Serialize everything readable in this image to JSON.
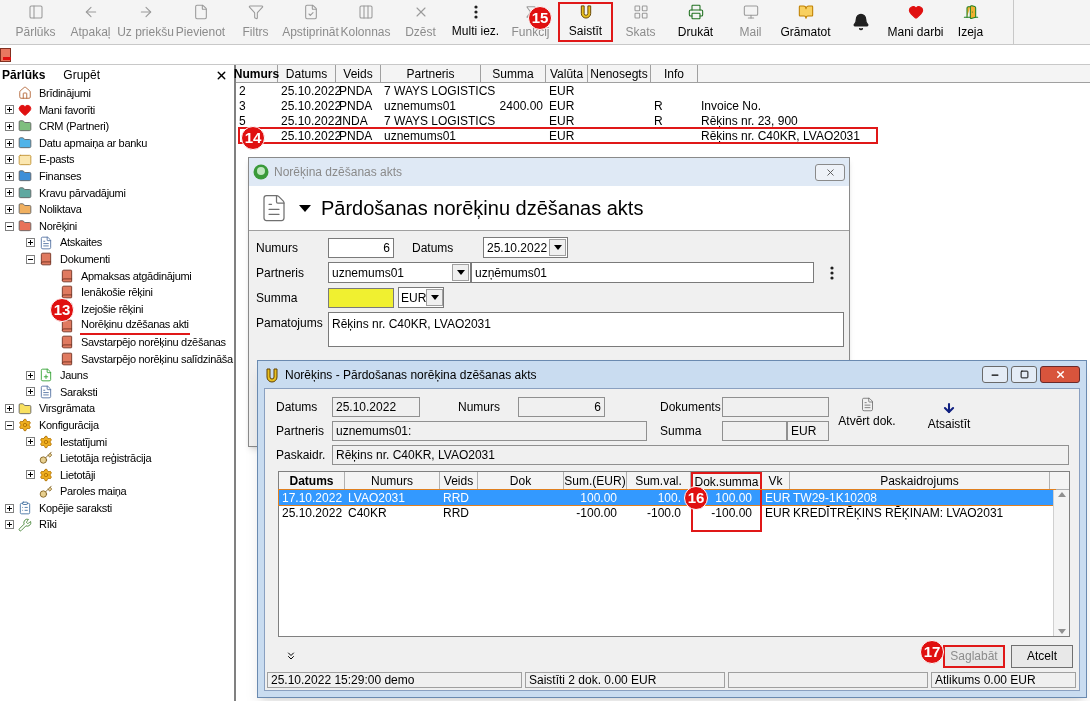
{
  "toolbar": {
    "items": [
      {
        "label": "Pārlūks",
        "kind": "panel",
        "disabled": true,
        "highlighted": false
      },
      {
        "label": "Atpakaļ",
        "kind": "back",
        "disabled": true,
        "highlighted": false
      },
      {
        "label": "Uz priekšu",
        "kind": "forward",
        "disabled": true,
        "highlighted": false
      },
      {
        "label": "Pievienot",
        "kind": "file",
        "disabled": true,
        "highlighted": false
      },
      {
        "label": "Filtrs",
        "kind": "filter",
        "disabled": true,
        "highlighted": false
      },
      {
        "label": "Apstiprināt",
        "kind": "approve",
        "disabled": true,
        "highlighted": false
      },
      {
        "label": "Kolonnas",
        "kind": "columns",
        "disabled": true,
        "highlighted": false
      },
      {
        "label": "Dzēst",
        "kind": "delete",
        "disabled": true,
        "highlighted": false
      },
      {
        "label": "Multi iez.",
        "kind": "more",
        "disabled": false,
        "highlighted": false
      },
      {
        "label": "Funkcij",
        "kind": "function",
        "disabled": true,
        "highlighted": false
      },
      {
        "label": "Saistīt",
        "kind": "link",
        "disabled": false,
        "highlighted": true
      },
      {
        "label": "Skats",
        "kind": "grid",
        "disabled": true,
        "highlighted": false
      },
      {
        "label": "Drukāt",
        "kind": "print",
        "disabled": false,
        "highlighted": false
      },
      {
        "label": "Mail",
        "kind": "mail",
        "disabled": true,
        "highlighted": false
      },
      {
        "label": "Grāmatot",
        "kind": "book",
        "disabled": false,
        "highlighted": false
      },
      {
        "kind": "bell",
        "disabled": false,
        "highlighted": false
      },
      {
        "label": "Mani darbi",
        "kind": "heart",
        "disabled": false,
        "highlighted": false
      },
      {
        "label": "Izeja",
        "kind": "exit",
        "disabled": false,
        "highlighted": false
      }
    ]
  },
  "sidebar": {
    "tabs": [
      {
        "label": "Pārlūks",
        "selected": true
      },
      {
        "label": "Grupēt",
        "selected": false
      }
    ],
    "tree": [
      {
        "label": "Brīdinājumi",
        "kind": "house"
      },
      {
        "label": "Mani favorīti",
        "kind": "heart",
        "expanded": false
      },
      {
        "label": "CRM (Partneri)",
        "kind": "folder",
        "color": "#7fbf7f",
        "expanded": false
      },
      {
        "label": "Datu apmaiņa ar banku",
        "kind": "folder",
        "color": "#4fb3e8",
        "expanded": false
      },
      {
        "label": "E-pasts",
        "kind": "envelope",
        "expanded": false
      },
      {
        "label": "Finanses",
        "kind": "folder",
        "color": "#3f8fd8",
        "expanded": false
      },
      {
        "label": "Kravu pārvadājumi",
        "kind": "folder",
        "color": "#5fa8a0",
        "expanded": false
      },
      {
        "label": "Noliktava",
        "kind": "folder",
        "color": "#f0b060",
        "expanded": false
      },
      {
        "label": "Norēķini",
        "kind": "folder",
        "color": "#e8735a",
        "expanded": true,
        "children": [
          {
            "label": "Atskaites",
            "kind": "list",
            "expanded": false
          },
          {
            "label": "Dokumenti",
            "kind": "book",
            "expanded": true,
            "children": [
              {
                "label": "Apmaksas atgādinājumi",
                "kind": "book",
                "highlighted": false
              },
              {
                "label": "Ienākošie rēķini",
                "kind": "book",
                "highlighted": false
              },
              {
                "label": "Izejošie rēķini",
                "kind": "book",
                "highlighted": false
              },
              {
                "label": "Norēķinu dzēšanas akti",
                "kind": "book",
                "highlighted": true
              },
              {
                "label": "Savstarpējo norēķinu dzēšanas",
                "kind": "book",
                "highlighted": false
              },
              {
                "label": "Savstarpējo norēķinu salīdzināša",
                "kind": "book",
                "highlighted": false
              }
            ]
          },
          {
            "label": "Jauns",
            "kind": "new",
            "expanded": false
          },
          {
            "label": "Saraksti",
            "kind": "list",
            "expanded": false
          }
        ]
      },
      {
        "label": "Virsgrāmata",
        "kind": "folder",
        "color": "#f8e060",
        "expanded": false
      },
      {
        "label": "Konfigurācija",
        "kind": "gear",
        "expanded": true,
        "children": [
          {
            "label": "Iestatījumi",
            "kind": "gear",
            "expanded": false
          },
          {
            "label": "Lietotāja reģistrācija",
            "kind": "key"
          },
          {
            "label": "Lietotāji",
            "kind": "gear",
            "expanded": false
          },
          {
            "label": "Paroles maiņa",
            "kind": "key"
          }
        ]
      },
      {
        "label": "Kopējie saraksti",
        "kind": "clipboard",
        "expanded": false
      },
      {
        "label": "Rīki",
        "kind": "tools",
        "expanded": false
      }
    ]
  },
  "table": {
    "columns": [
      "Numurs",
      "Datums",
      "Veids",
      "Partneris",
      "Summa",
      "Valūta",
      "Nenosegts",
      "Info"
    ],
    "rows": [
      {
        "cells": [
          "2",
          "25.10.2022",
          "PNDA",
          "7 WAYS LOGISTICS",
          "",
          "EUR",
          "",
          "",
          ""
        ],
        "highlighted": false
      },
      {
        "cells": [
          "3",
          "25.10.2022",
          "PNDA",
          "uznemums01",
          "2400.00",
          "EUR",
          "",
          "R",
          "Invoice No."
        ],
        "highlighted": false
      },
      {
        "cells": [
          "5",
          "25.10.2022",
          "INDA",
          "7 WAYS LOGISTICS",
          "",
          "EUR",
          "",
          "R",
          "Rēķins nr. 23, 900"
        ],
        "highlighted": false
      },
      {
        "cells": [
          "",
          "25.10.2022",
          "PNDA",
          "uznemums01",
          "",
          "EUR",
          "",
          "",
          "Rēķins nr. C40KR, LVAO2031"
        ],
        "highlighted": true
      }
    ]
  },
  "dialog_act": {
    "title": "Norēķina dzēšanas akts",
    "heading": "Pārdošanas norēķinu dzēšanas akts",
    "numurs_label": "Numurs",
    "numurs": "6",
    "datums_label": "Datums",
    "datums": "25.10.2022",
    "partneris_label": "Partneris",
    "partneris_code": "uznemums01",
    "partneris_name": "uzņēmums01",
    "summa_label": "Summa",
    "currency": "EUR",
    "pamatojums_label": "Pamatojums",
    "pamatojums": "Rēķins nr. C40KR, LVAO2031"
  },
  "dialog_link": {
    "title": "Norēķins - Pārdošanas norēķina dzēšanas akts",
    "datums_label": "Datums",
    "datums": "25.10.2022",
    "numurs_label": "Numurs",
    "numurs": "6",
    "dokuments_label": "Dokuments",
    "partneris_label": "Partneris",
    "partneris": "uznemums01:",
    "summa_label": "Summa",
    "currency": "EUR",
    "paskaidr_label": "Paskaidr.",
    "paskaidr": "Rēķins nr. C40KR, LVAO2031",
    "open_button": "Atvērt dok.",
    "unlink_button": "Atsaistīt",
    "columns": [
      {
        "label": "Datums",
        "highlighted": false
      },
      {
        "label": "Numurs",
        "highlighted": false
      },
      {
        "label": "Veids",
        "highlighted": false
      },
      {
        "label": "Dok",
        "highlighted": false
      },
      {
        "label": "Sum.(EUR)",
        "highlighted": false
      },
      {
        "label": "Sum.val.",
        "highlighted": false
      },
      {
        "label": "Dok.summa",
        "highlighted": true
      },
      {
        "label": "Vk",
        "highlighted": false
      },
      {
        "label": "Paskaidrojums",
        "highlighted": false
      }
    ],
    "rows": [
      {
        "cells": [
          "17.10.2022",
          "LVAO2031",
          "RRD",
          "",
          "100.00",
          "100.",
          "100.00",
          "EUR",
          "TW29-1K10208"
        ],
        "selected": true
      },
      {
        "cells": [
          "25.10.2022",
          "C40KR",
          "RRD",
          "",
          "-100.00",
          "-100.0",
          "-100.00",
          "EUR",
          "KREDĪTRĒĶINS RĒĶINAM: LVAO2031"
        ],
        "selected": false
      }
    ],
    "buttons": [
      {
        "label": "Saglabāt",
        "disabled": true,
        "highlighted": true
      },
      {
        "label": "Atcelt",
        "disabled": false,
        "highlighted": false
      }
    ],
    "status_bar": [
      "25.10.2022 15:29:00 demo",
      "Saistīti 2 dok. 0.00 EUR",
      "Atlikums 0.00 EUR"
    ]
  },
  "callouts": [
    "13",
    "14",
    "15",
    "16",
    "17"
  ]
}
